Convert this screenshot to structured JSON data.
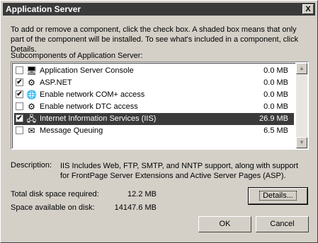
{
  "window": {
    "title": "Application Server",
    "close_glyph": "X"
  },
  "intro": "To add or remove a component, click the check box. A shaded box means that only part of the component will be installed. To see what's included in a component, click Details.",
  "subcomponents_label": "Subcomponents of Application Server:",
  "components": [
    {
      "name": "Application Server Console",
      "size": "0.0 MB",
      "checked": false,
      "icon": "console-icon"
    },
    {
      "name": "ASP.NET",
      "size": "0.0 MB",
      "checked": true,
      "icon": "aspnet-icon"
    },
    {
      "name": "Enable network COM+ access",
      "size": "0.0 MB",
      "checked": true,
      "icon": "complus-icon"
    },
    {
      "name": "Enable network DTC access",
      "size": "0.0 MB",
      "checked": false,
      "icon": "dtc-icon"
    },
    {
      "name": "Internet Information Services (IIS)",
      "size": "26.9 MB",
      "checked": true,
      "icon": "iis-icon",
      "selected": true
    },
    {
      "name": "Message Queuing",
      "size": "6.5 MB",
      "checked": false,
      "icon": "message-queuing-icon"
    }
  ],
  "description": {
    "label": "Description:",
    "text": "IIS Includes Web, FTP, SMTP, and NNTP support, along with support for FrontPage Server Extensions and Active Server Pages (ASP)."
  },
  "disk": {
    "required_label": "Total disk space required:",
    "required_value": "12.2 MB",
    "available_label": "Space available on disk:",
    "available_value": "14147.6 MB"
  },
  "buttons": {
    "details": "Details...",
    "ok": "OK",
    "cancel": "Cancel"
  }
}
